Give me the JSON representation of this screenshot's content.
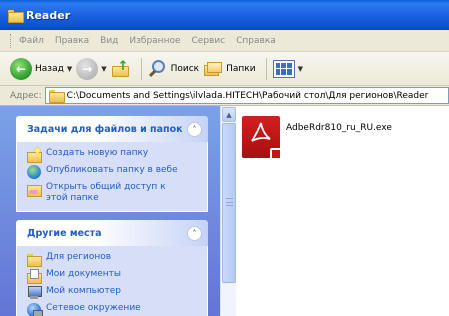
{
  "window": {
    "title": "Reader"
  },
  "menu": {
    "items": [
      "Файл",
      "Правка",
      "Вид",
      "Избранное",
      "Сервис",
      "Справка"
    ]
  },
  "toolbar": {
    "back_label": "Назад",
    "search_label": "Поиск",
    "folders_label": "Папки"
  },
  "address": {
    "label": "Адрес:",
    "value": "C:\\Documents and Settings\\ilvlada.HITECH\\Рабочий стол\\Для регионов\\Reader"
  },
  "tasks_panel": {
    "title": "Задачи для файлов и папок",
    "items": [
      "Создать новую папку",
      "Опубликовать папку в вебе",
      "Открыть общий доступ к этой папке"
    ]
  },
  "places_panel": {
    "title": "Другие места",
    "items": [
      "Для регионов",
      "Мои документы",
      "Мой компьютер",
      "Сетевое окружение"
    ]
  },
  "files": [
    {
      "name": "AdbeRdr810_ru_RU.exe",
      "icon": "adobe-reader-icon"
    }
  ],
  "colors": {
    "titlebar": "#1b62e0",
    "panel_link": "#215dc6",
    "left_pane": "#7ba2e7",
    "acrobat_red": "#c51515"
  }
}
